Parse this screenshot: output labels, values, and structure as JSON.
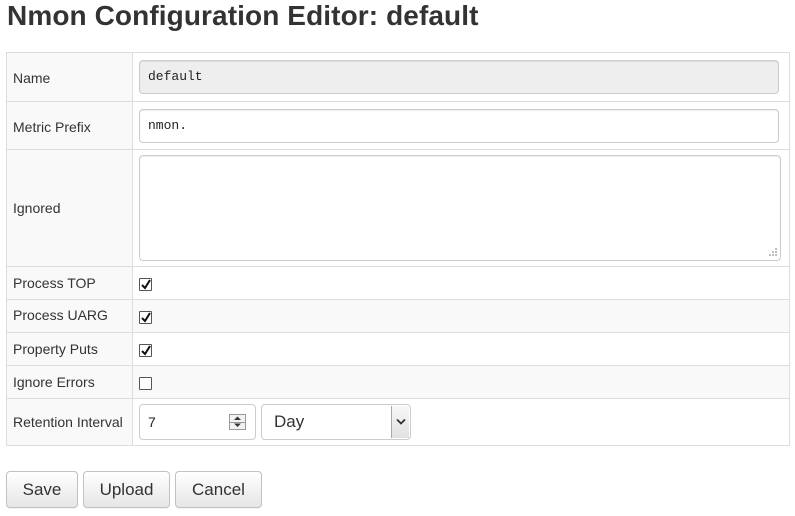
{
  "page": {
    "title": "Nmon Configuration Editor: default"
  },
  "form": {
    "name": {
      "label": "Name",
      "value": "default"
    },
    "metric_prefix": {
      "label": "Metric Prefix",
      "value": "nmon."
    },
    "ignored": {
      "label": "Ignored",
      "value": ""
    },
    "process_top": {
      "label": "Process TOP",
      "checked": true
    },
    "process_uarg": {
      "label": "Process UARG",
      "checked": true
    },
    "property_puts": {
      "label": "Property Puts",
      "checked": true
    },
    "ignore_errors": {
      "label": "Ignore Errors",
      "checked": false
    },
    "retention_interval": {
      "label": "Retention Interval",
      "value": "7",
      "unit": "Day"
    }
  },
  "buttons": {
    "save": "Save",
    "upload": "Upload",
    "cancel": "Cancel"
  },
  "icons": {
    "checkmark": "checkmark-icon",
    "spinner": "spinner-arrows-icon",
    "dropdown": "chevron-down-icon",
    "resize": "resize-grip-icon"
  }
}
